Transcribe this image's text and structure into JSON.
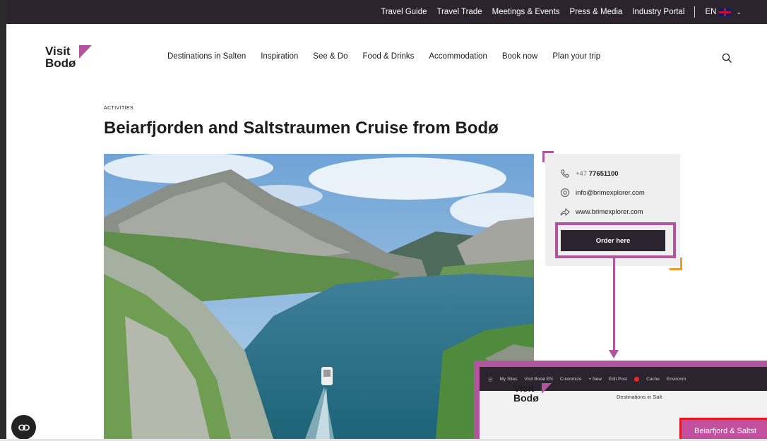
{
  "topbar": {
    "links": [
      "Travel Guide",
      "Travel Trade",
      "Meetings & Events",
      "Press & Media",
      "Industry Portal"
    ],
    "language": "EN"
  },
  "logo": {
    "line1": "Visit",
    "line2": "Bodø"
  },
  "nav": {
    "items": [
      "Destinations in Salten",
      "Inspiration",
      "See & Do",
      "Food & Drinks",
      "Accommodation",
      "Book now",
      "Plan your trip"
    ]
  },
  "article": {
    "category": "ACTIVITIES",
    "title": "Beiarfjorden and Saltstraumen Cruise from Bodø"
  },
  "contact": {
    "phone_prefix": "+47",
    "phone_number": "77651100",
    "email": "info@brimexplorer.com",
    "website": "www.brimexplorer.com",
    "order_label": "Order here"
  },
  "inset": {
    "adminbar": [
      "My Sites",
      "Visit Bodø EN",
      "Customize",
      "+ New",
      "Edit Post",
      "Cache",
      "Environm"
    ],
    "logo_line1": "Visit",
    "logo_line2": "Bodø",
    "nav_item": "Destinations in Salt",
    "banner": "Beiarfjord & Saltst"
  },
  "colors": {
    "brand_pink": "#b1559f",
    "dark": "#2b232e",
    "accent_orange": "#f29b2b"
  }
}
